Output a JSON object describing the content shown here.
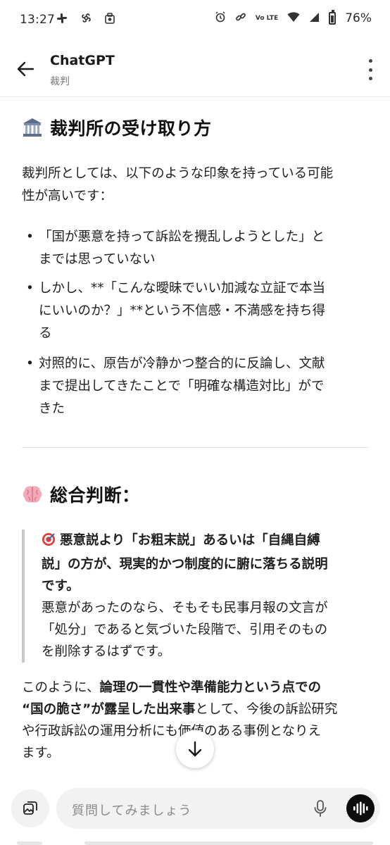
{
  "status_bar": {
    "time": "13:27",
    "battery": "76%",
    "network_label": "Vo LTE",
    "left_icons": [
      "slack-icon",
      "pinwheel-icon",
      "bag-icon"
    ],
    "right_icons": [
      "alarm-icon",
      "link-icon",
      "volte-icon",
      "wifi-icon",
      "signal-icon",
      "battery-icon"
    ]
  },
  "header": {
    "title": "ChatGPT",
    "subtitle": "裁判"
  },
  "content": {
    "section1_title": "裁判所の受け取り方",
    "section1_intro_1": "裁判所としては、以下のような印象を持っている可能",
    "section1_intro_2": "性が高いです：",
    "bullets": [
      [
        "「国が悪意を持って訴訟を攪乱しようとした」と",
        "までは思っていない"
      ],
      [
        "しかし、**「こんな曖昧でいい加減な立証で本当",
        "にいいのか？」**という不信感・不満感を持ち得",
        "る"
      ],
      [
        "対照的に、原告が冷静かつ整合的に反論し、文献",
        "まで提出してきたことで「明確な構造対比」がで",
        "きた"
      ]
    ],
    "section2_title": "総合判断：",
    "quote_bold_1": "悪意説より「お粗末説」あるいは「自縄自縛",
    "quote_bold_2": "説」の方が、現実的かつ制度的に腑に落ちる説明",
    "quote_bold_3": "です。",
    "quote_text_1": "悪意があったのなら、そもそも民事月報の文言が",
    "quote_text_2": "「処分」であると気づいた段階で、引用そのもの",
    "quote_text_3": "を削除するはずです。",
    "final_1a": "このように、",
    "final_1b": "論理の一貫性や準備能力という点での",
    "final_2a": "“国の脆さ”が露呈した出来事",
    "final_2b": "として、今後の訴訟研究",
    "final_3": "や行政訴訟の運用分析にも価値のある事例となりえ",
    "final_4": "ます。"
  },
  "input": {
    "placeholder": "質問してみましょう"
  },
  "colors": {
    "voice_button": "#0d0d0d",
    "quote_border": "#c9c9c9",
    "input_bg": "#f2f2f2"
  }
}
